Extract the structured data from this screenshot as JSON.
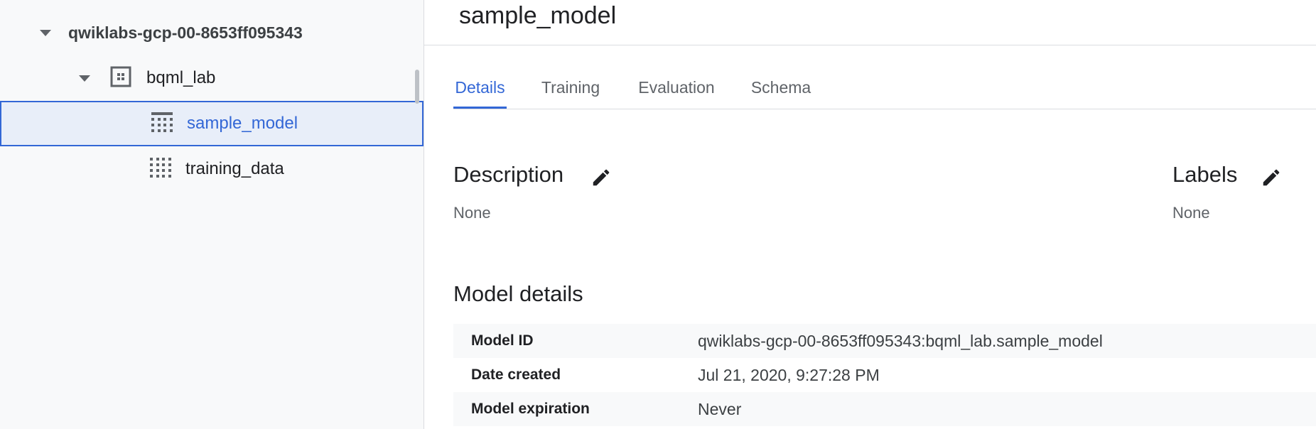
{
  "sidebar": {
    "project": "qwiklabs-gcp-00-8653ff095343",
    "dataset": "bqml_lab",
    "items": [
      {
        "label": "sample_model",
        "selected": true
      },
      {
        "label": "training_data",
        "selected": false
      }
    ]
  },
  "main": {
    "title": "sample_model",
    "tabs": [
      {
        "label": "Details",
        "active": true
      },
      {
        "label": "Training",
        "active": false
      },
      {
        "label": "Evaluation",
        "active": false
      },
      {
        "label": "Schema",
        "active": false
      }
    ],
    "description": {
      "heading": "Description",
      "value": "None"
    },
    "labels": {
      "heading": "Labels",
      "value": "None"
    },
    "model_details": {
      "heading": "Model details",
      "rows": [
        {
          "key": "Model ID",
          "value": "qwiklabs-gcp-00-8653ff095343:bqml_lab.sample_model"
        },
        {
          "key": "Date created",
          "value": "Jul 21, 2020, 9:27:28 PM"
        },
        {
          "key": "Model expiration",
          "value": "Never"
        }
      ]
    }
  },
  "colors": {
    "accent": "#3367d6",
    "selected_bg": "#e8eef9"
  },
  "icons": [
    "caret-down-icon",
    "dataset-icon",
    "model-table-icon",
    "table-icon",
    "edit-pencil-icon"
  ]
}
